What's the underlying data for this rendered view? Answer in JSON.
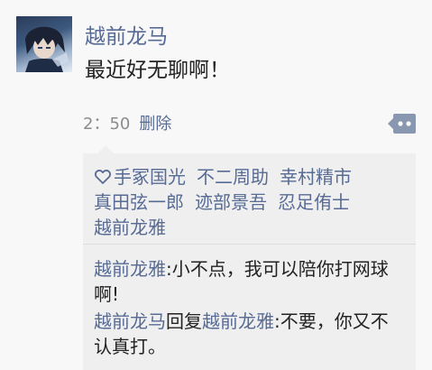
{
  "post": {
    "username": "越前龙马",
    "text": "最近好无聊啊！",
    "time": "2：50",
    "delete_label": "删除"
  },
  "likes": {
    "icon": "heart-outline-icon",
    "names": [
      "手冢国光",
      "不二周助",
      "幸村精市",
      "真田弦一郎",
      "迹部景吾",
      "忍足侑士",
      "越前龙雅"
    ]
  },
  "comments": [
    {
      "author": "越前龙雅",
      "separator": ":",
      "text": "小不点，我可以陪你打网球啊!"
    },
    {
      "author": "越前龙马",
      "reply_word": "回复",
      "reply_to": "越前龙雅",
      "separator": ":",
      "text": "不要，你又不认真打。"
    }
  ],
  "colors": {
    "link": "#576b95",
    "text": "#222222",
    "meta": "#8c8c8c",
    "background": "#f8f8f8",
    "comment_box": "#efefef"
  }
}
